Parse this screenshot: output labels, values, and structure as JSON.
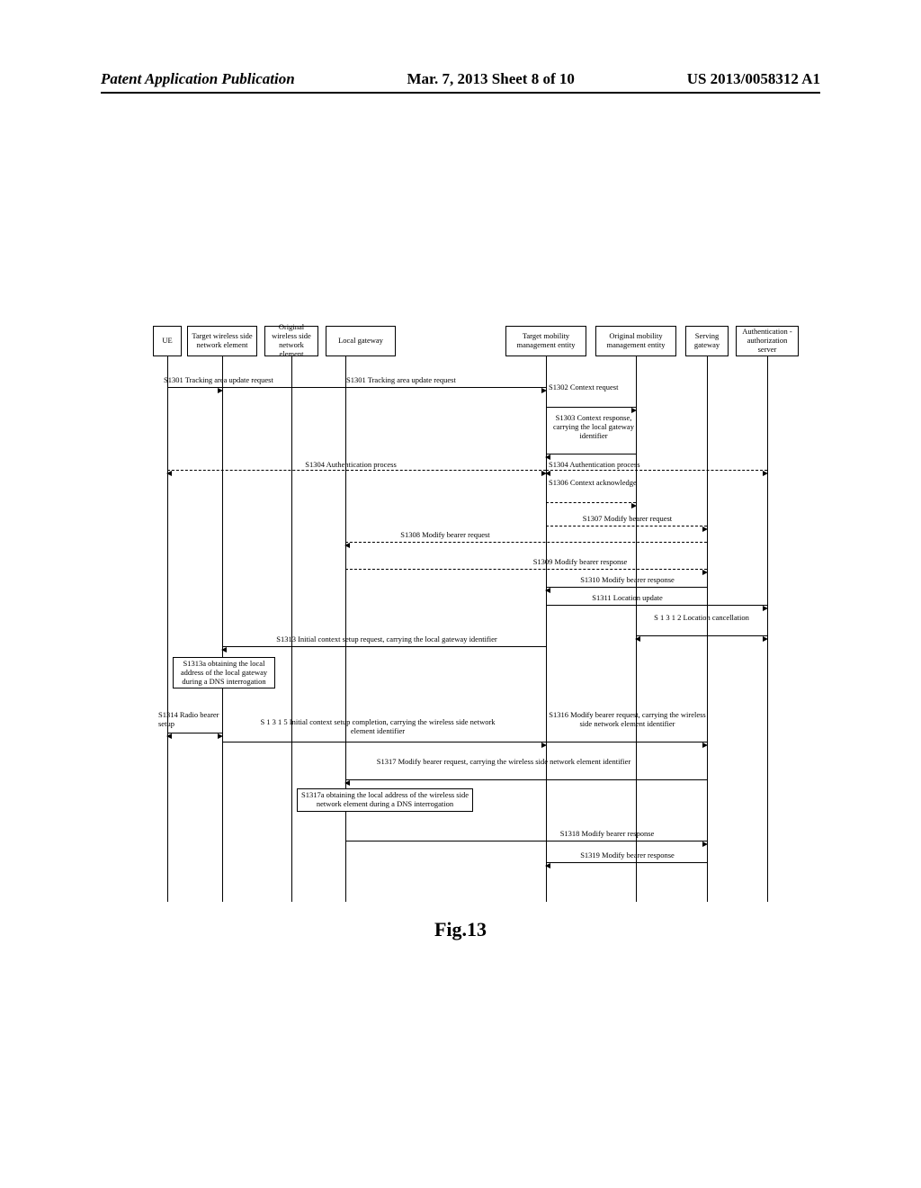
{
  "header": {
    "left": "Patent Application Publication",
    "mid": "Mar. 7, 2013  Sheet 8 of 10",
    "right": "US 2013/0058312 A1"
  },
  "actors": {
    "ue": "UE",
    "target_wse": "Target wireless side network element",
    "original_wse": "Original wireless side network element",
    "local_gw": "Local gateway",
    "target_mme": "Target mobility management entity",
    "original_mme": "Original mobility management entity",
    "serving_gw": "Serving gateway",
    "auth_server": "Authentication -authorization server"
  },
  "msgs": {
    "s1301a": "S1301 Tracking area update request",
    "s1301b": "S1301  Tracking area update request",
    "s1302": "S1302 Context request",
    "s1303": "S1303 Context response, carrying the local gateway identifier",
    "s1304a": "S1304 Authentication process",
    "s1304b": "S1304 Authentication process",
    "s1306": "S1306 Context acknowledge",
    "s1307": "S1307 Modify bearer request",
    "s1308": "S1308 Modify bearer request",
    "s1309": "S1309  Modify bearer response",
    "s1310": "S1310 Modify bearer response",
    "s1311": "S1311 Location update",
    "s1312": "S 1 3 1 2  Location cancellation",
    "s1313": "S1313  Initial context setup request, carrying the local gateway identifier",
    "s1313a": "S1313a obtaining the local address of the local gateway during a DNS interrogation",
    "s1314": "S1314 Radio bearer setup",
    "s1315": "S 1 3 1 5  Initial context setup completion, carrying the wireless side network element identifier",
    "s1316": "S1316 Modify bearer request, carrying the wireless side network element identifier",
    "s1317": "S1317 Modify bearer request, carrying the wireless side network element identifier",
    "s1317a": "S1317a  obtaining the local address of the wireless side network element during a  DNS interrogation",
    "s1318": "S1318 Modify bearer response",
    "s1319": "S1319 Modify bearer response"
  },
  "figure": "Fig.13"
}
